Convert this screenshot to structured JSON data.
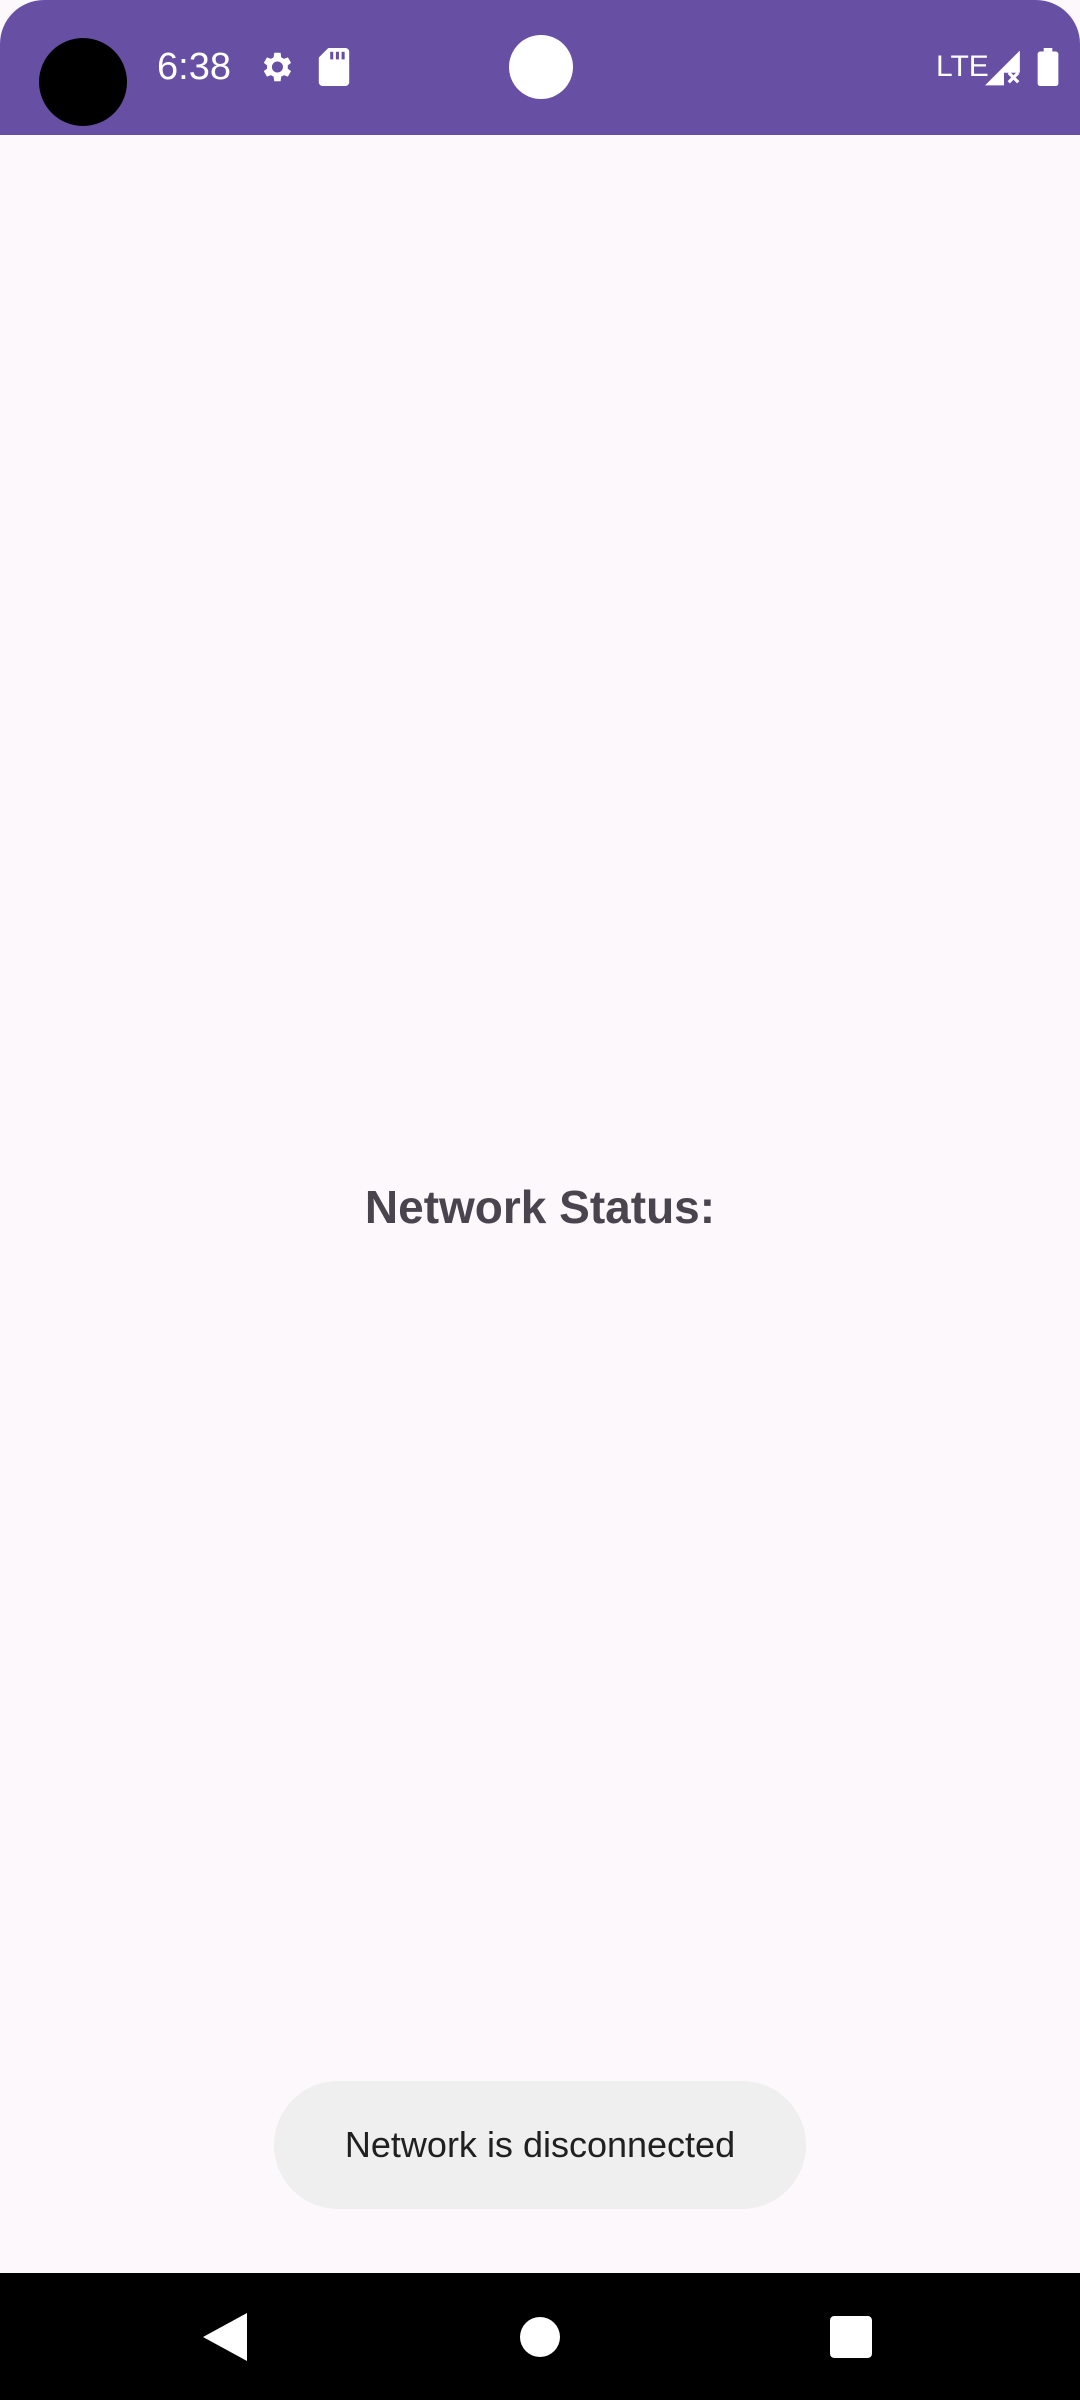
{
  "status_bar": {
    "time": "6:38",
    "network_type": "LTE",
    "icons": [
      "settings-icon",
      "sd-card-icon",
      "signal-icon",
      "battery-icon"
    ],
    "background_color": "#6750a4"
  },
  "main": {
    "network_status_label": "Network Status:"
  },
  "toast": {
    "message": "Network is disconnected"
  },
  "nav_bar": {
    "buttons": [
      "back-icon",
      "home-icon",
      "recents-icon"
    ]
  }
}
